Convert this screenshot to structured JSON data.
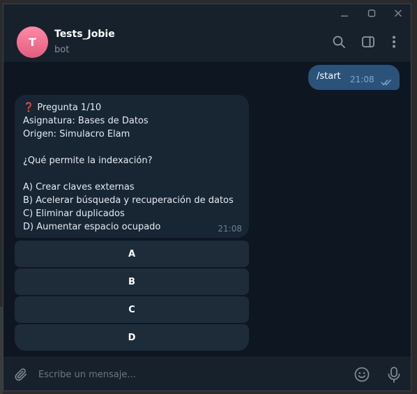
{
  "window": {
    "controls": [
      "minimize-icon",
      "maximize-icon",
      "close-icon"
    ]
  },
  "header": {
    "avatar_letter": "T",
    "chat_name": "Tests_Jobie",
    "status": "bot",
    "icons": [
      "search-icon",
      "sidebar-panel-icon",
      "more-vertical-icon"
    ]
  },
  "messages": {
    "outgoing": {
      "text": "/start",
      "time": "21:08",
      "status_icon": "double-check-icon"
    },
    "incoming": {
      "question_icon": "❓",
      "lines": [
        "Pregunta 1/10",
        "Asignatura: Bases de Datos",
        "Origen: Simulacro Elam",
        "",
        "¿Qué permite la indexación?",
        "",
        "A) Crear claves externas",
        "B) Acelerar búsqueda y recuperación de datos",
        "C) Eliminar duplicados",
        "D) Aumentar espacio ocupado"
      ],
      "time": "21:08"
    },
    "keyboard": [
      "A",
      "B",
      "C",
      "D"
    ]
  },
  "composer": {
    "placeholder": "Escribe un mensaje...",
    "icons": [
      "paperclip-icon",
      "emoji-icon",
      "microphone-icon"
    ]
  },
  "colors": {
    "window_bg": "#0e1621",
    "panel_bg": "#17212b",
    "outgoing_bubble": "#2b5278",
    "incoming_bubble": "#182533",
    "keyboard_button": "#1e2c3a",
    "avatar": "#e35d7e"
  }
}
